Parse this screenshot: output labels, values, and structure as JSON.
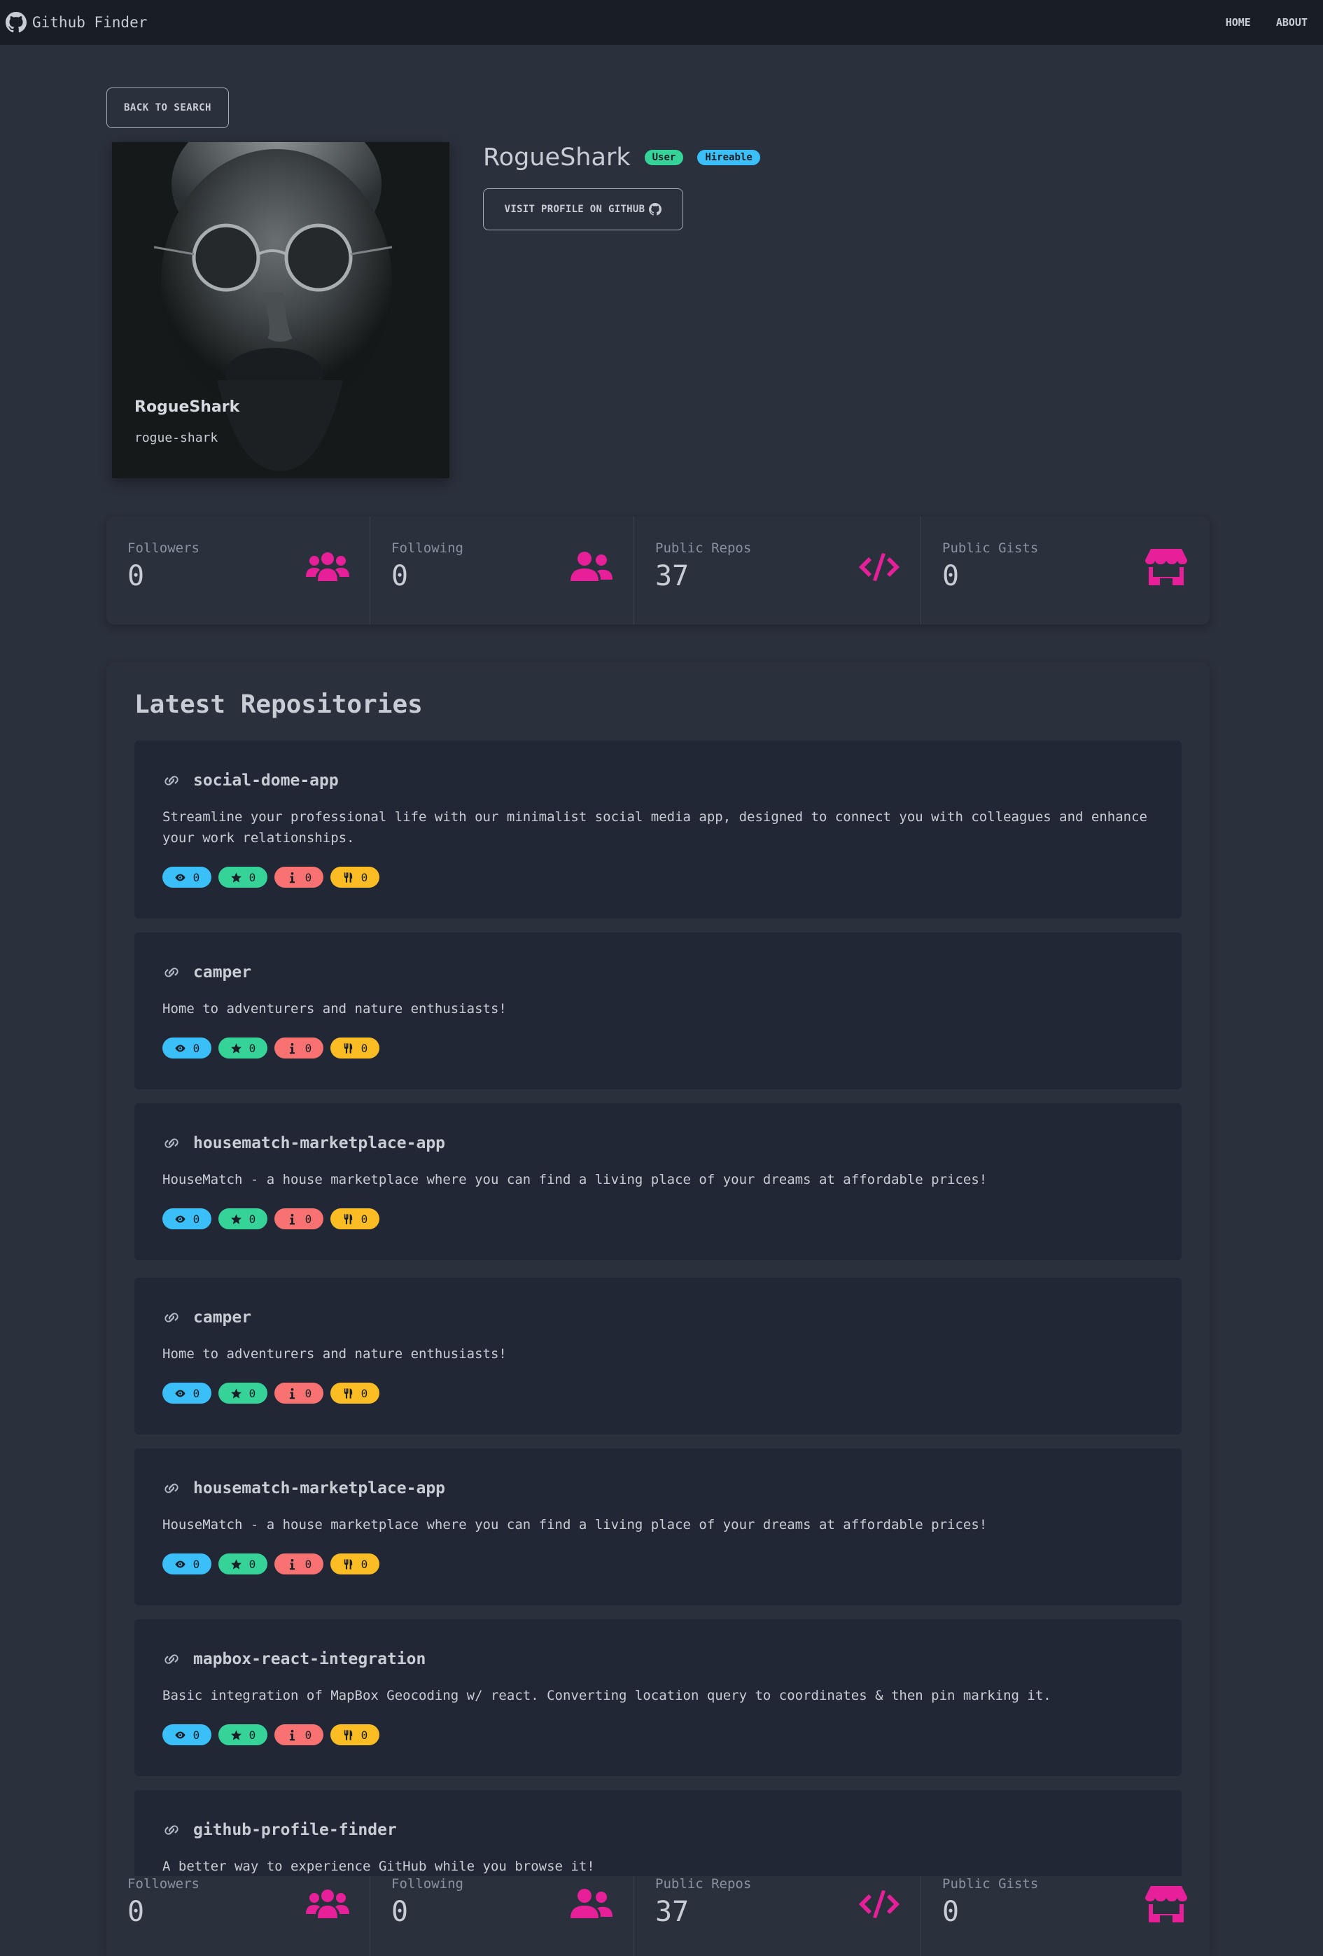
{
  "navbar": {
    "brand": "Github Finder",
    "links": [
      "HOME",
      "ABOUT"
    ]
  },
  "back_button": "BACK TO SEARCH",
  "user": {
    "display_name": "RogueShark",
    "login": "rogue-shark",
    "type_badge": "User",
    "hireable_badge": "Hireable",
    "visit_button": "VISIT PROFILE ON GITHUB"
  },
  "stats": [
    {
      "title": "Followers",
      "value": "0",
      "icon": "users-icon"
    },
    {
      "title": "Following",
      "value": "0",
      "icon": "user-friends-icon"
    },
    {
      "title": "Public Repos",
      "value": "37",
      "icon": "code-icon"
    },
    {
      "title": "Public Gists",
      "value": "0",
      "icon": "store-icon"
    }
  ],
  "repos_title": "Latest Repositories",
  "repos": [
    {
      "name": "social-dome-app",
      "description": "Streamline your professional life with our minimalist social media app, designed to connect you with colleagues and enhance your work relationships.",
      "watchers": "0",
      "stars": "0",
      "issues": "0",
      "forks": "0"
    },
    {
      "name": "camper",
      "description": "Home to adventurers and nature enthusiasts!",
      "watchers": "0",
      "stars": "0",
      "issues": "0",
      "forks": "0"
    },
    {
      "name": "housematch-marketplace-app",
      "description": "HouseMatch - a house marketplace where you can find a living place of your dreams at affordable prices!",
      "watchers": "0",
      "stars": "0",
      "issues": "0",
      "forks": "0"
    },
    {
      "name": "camper",
      "description": "Home to adventurers and nature enthusiasts!",
      "watchers": "0",
      "stars": "0",
      "issues": "0",
      "forks": "0"
    },
    {
      "name": "housematch-marketplace-app",
      "description": "HouseMatch - a house marketplace where you can find a living place of your dreams at affordable prices!",
      "watchers": "0",
      "stars": "0",
      "issues": "0",
      "forks": "0"
    },
    {
      "name": "mapbox-react-integration",
      "description": "Basic integration of MapBox Geocoding w/ react. Converting location query to coordinates & then pin marking it.",
      "watchers": "0",
      "stars": "0",
      "issues": "0",
      "forks": "0"
    },
    {
      "name": "github-profile-finder",
      "description": "A better way to experience GitHub while you browse it!"
    }
  ],
  "colors": {
    "accent_icon": "#e7209a",
    "badge_user": "#36d399",
    "badge_hireable": "#3abff8",
    "watch": "#3abff8",
    "star": "#36d399",
    "issue": "#f87272",
    "fork": "#fbbd23"
  }
}
